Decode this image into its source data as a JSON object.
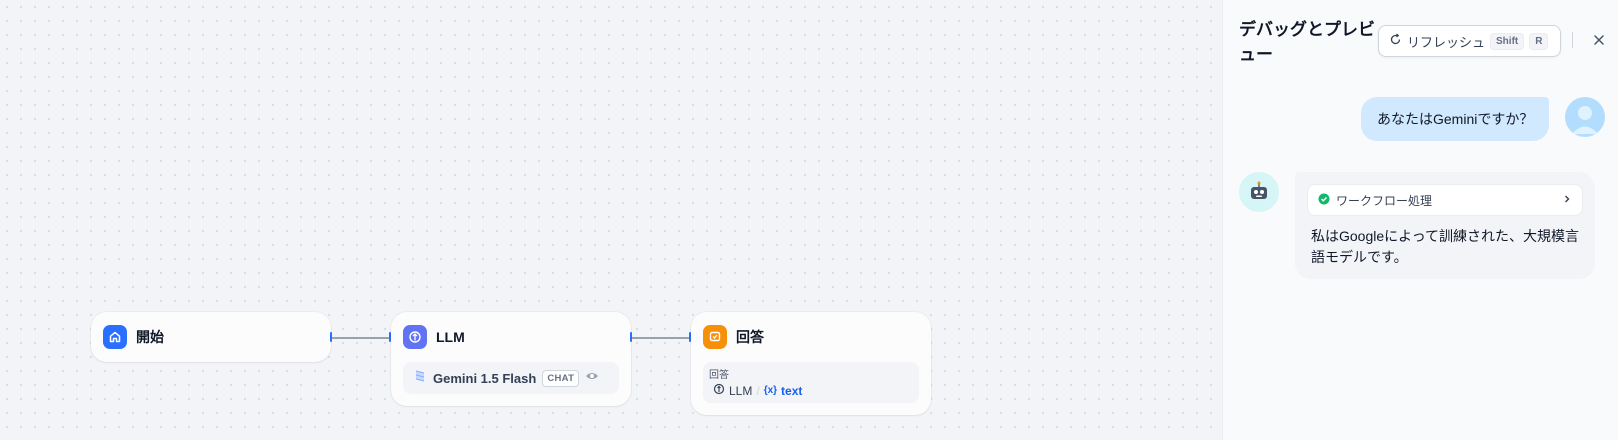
{
  "workflow": {
    "nodes": {
      "start": {
        "title": "開始",
        "icon": "home-icon",
        "color": "#2970ff"
      },
      "llm": {
        "title": "LLM",
        "icon": "llm-icon",
        "color": "#6172f3",
        "model_name": "Gemini 1.5 Flash",
        "model_mode": "CHAT",
        "model_icon": "gemini-model-icon"
      },
      "answer": {
        "title": "回答",
        "icon": "answer-icon",
        "color": "#f79009",
        "field_label": "回答",
        "ref_node": "LLM",
        "ref_separator": "/",
        "ref_var_prefix": "{x}",
        "ref_var": "text"
      }
    }
  },
  "panel": {
    "title": "デバッグとプレビュー",
    "refresh_label": "リフレッシュ",
    "shortcut_keys": [
      "Shift",
      "R"
    ],
    "close_icon": "close-icon",
    "messages": [
      {
        "role": "user",
        "text": "あなたはGeminiですか？"
      },
      {
        "role": "assistant",
        "workflow_label": "ワークフロー処理",
        "workflow_status": "success",
        "text": "私はGoogleによって訓練された、大規模言語モデルです。"
      }
    ]
  },
  "colors": {
    "accent": "#2970ff",
    "success": "#12b76a",
    "user_bubble": "#d1e9ff"
  }
}
